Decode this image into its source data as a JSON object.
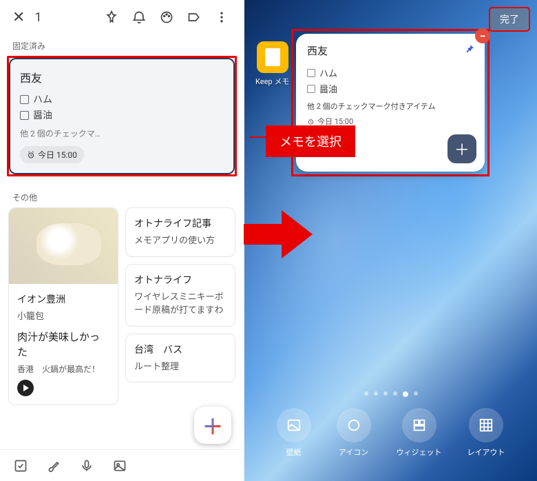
{
  "left": {
    "selected_count": "1",
    "pinned_label": "固定済み",
    "selected_note": {
      "title": "西友",
      "item1": "ハム",
      "item2": "醤油",
      "more": "他 2 個のチェックマ…",
      "reminder": "今日 15:00"
    },
    "callout_select": "メモを選択",
    "others_label": "その他",
    "img_note": {
      "location": "イオン豊洲",
      "subtitle": "小籠包",
      "body": "肉汁が美味しかった",
      "body2": "香港　火鍋が最高だ！"
    },
    "card_a": {
      "title": "オトナライフ記事",
      "body": "メモアプリの使い方"
    },
    "card_b": {
      "title": "オトナライフ",
      "body": "ワイヤレスミニキーボード原稿が打てますわ"
    },
    "card_c": {
      "title": "台湾　バス",
      "body": "ルート整理"
    }
  },
  "right": {
    "done": "完了",
    "keep_label": "Keep メモ",
    "widget": {
      "title": "西友",
      "item1": "ハム",
      "item2": "醤油",
      "more": "他 2 個のチェックマーク付きアイテム",
      "reminder": "今日 15:00"
    },
    "dock": {
      "wallpaper": "壁紙",
      "icon": "アイコン",
      "widget": "ウィジェット",
      "layout": "レイアウト"
    }
  }
}
